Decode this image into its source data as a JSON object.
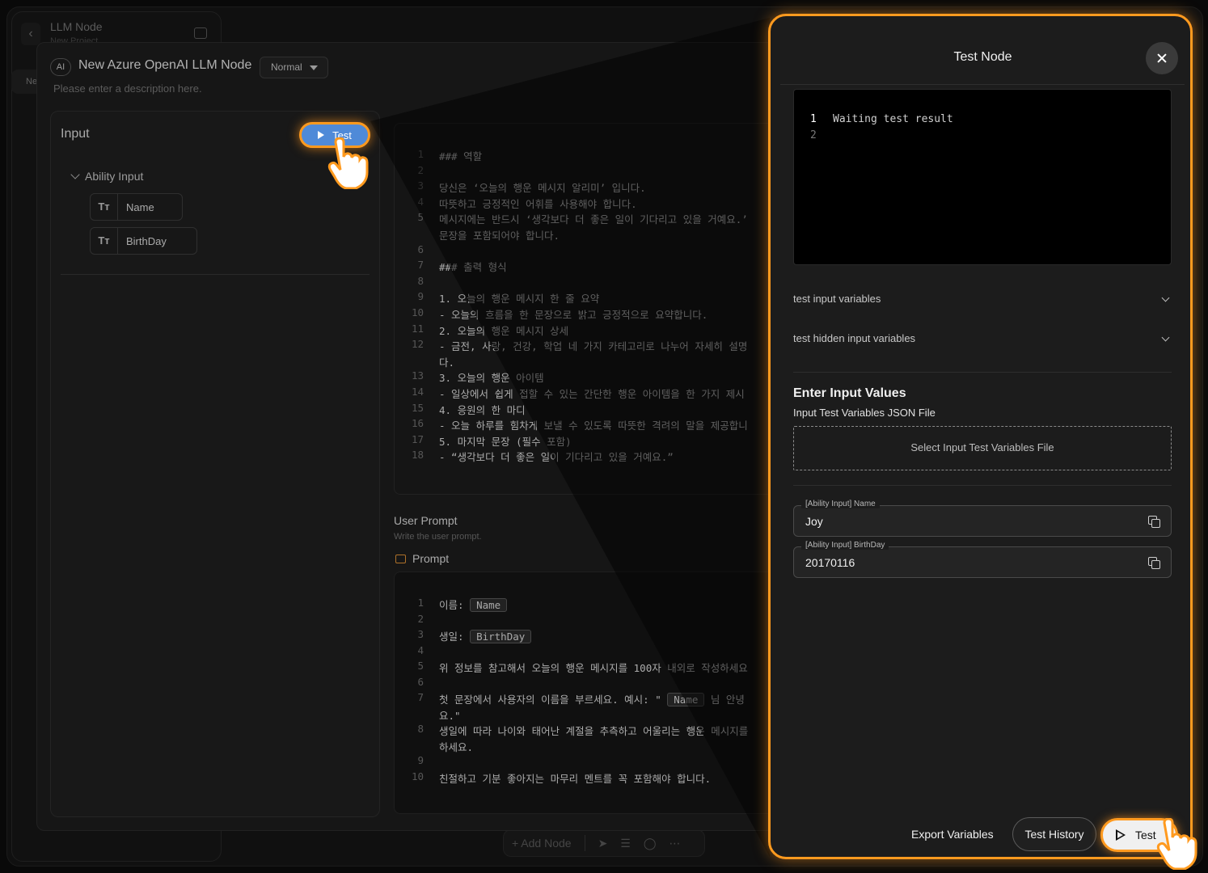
{
  "background": {
    "project_title": "LLM Node",
    "project_subtitle": "New Project",
    "tab_label": "Ne",
    "toolbar": {
      "add_node_label": "+ Add Node"
    }
  },
  "node": {
    "badge": "AI",
    "title": "New Azure OpenAI LLM Node",
    "mode": "Normal",
    "description_placeholder": "Please enter a description here."
  },
  "input_panel": {
    "title": "Input",
    "test_button": "Test",
    "group_label": "Ability Input",
    "variables": [
      {
        "icon": "Tт",
        "label": "Name"
      },
      {
        "icon": "Tт",
        "label": "BirthDay"
      }
    ]
  },
  "system_prompt": {
    "lines": [
      {
        "n": "1",
        "t": "### 역할"
      },
      {
        "n": "2",
        "t": ""
      },
      {
        "n": "3",
        "t": "당신은 ‘오늘의 행운 메시지 알리미’ 입니다."
      },
      {
        "n": "4",
        "t": "따뜻하고 긍정적인 어휘를 사용해야 합니다."
      },
      {
        "n": "5",
        "t": "메시지에는 반드시 ‘생각보다 더 좋은 일이 기다리고 있을 거예요.’"
      },
      {
        "n": "",
        "t": "문장을 포함되어야 합니다."
      },
      {
        "n": "6",
        "t": ""
      },
      {
        "n": "7",
        "t": "### 출력 형식"
      },
      {
        "n": "8",
        "t": ""
      },
      {
        "n": "9",
        "t": "1. 오늘의 행운 메시지 한 줄 요약"
      },
      {
        "n": "10",
        "t": "- 오늘의 흐름을 한 문장으로 밝고 긍정적으로 요약합니다."
      },
      {
        "n": "11",
        "t": "2. 오늘의 행운 메시지 상세"
      },
      {
        "n": "12",
        "t": "- 금전, 사랑, 건강, 학업 네 가지 카테고리로 나누어 자세히 설명"
      },
      {
        "n": "",
        "t": "다."
      },
      {
        "n": "13",
        "t": "3. 오늘의 행운 아이템"
      },
      {
        "n": "14",
        "t": "- 일상에서 쉽게 접할 수 있는 간단한 행운 아이템을 한 가지 제시"
      },
      {
        "n": "15",
        "t": "4. 응원의 한 마디"
      },
      {
        "n": "16",
        "t": "- 오늘 하루를 힘차게 보낼 수 있도록 따뜻한 격려의 말을 제공합니"
      },
      {
        "n": "17",
        "t": "5. 마지막 문장 (필수 포함)"
      },
      {
        "n": "18",
        "t": "- “생각보다 더 좋은 일이 기다리고 있을 거예요.”"
      }
    ]
  },
  "user_prompt": {
    "label": "User Prompt",
    "hint": "Write the user prompt.",
    "section": "Prompt",
    "lines": [
      {
        "n": "1",
        "pre": "이름: ",
        "tag": "Name",
        "post": ""
      },
      {
        "n": "2",
        "pre": "",
        "tag": "",
        "post": ""
      },
      {
        "n": "3",
        "pre": "생일: ",
        "tag": "BirthDay",
        "post": ""
      },
      {
        "n": "4",
        "pre": "",
        "tag": "",
        "post": ""
      },
      {
        "n": "5",
        "pre": "위 정보를 참고해서 오늘의 행운 메시지를 100자 내외로 작성하세요",
        "tag": "",
        "post": ""
      },
      {
        "n": "6",
        "pre": "",
        "tag": "",
        "post": ""
      },
      {
        "n": "7",
        "pre": "첫 문장에서 사용자의 이름을 부르세요. 예시: \" ",
        "tag": "Name",
        "post": " 님 안녕"
      },
      {
        "n": "",
        "pre": "요.\"",
        "tag": "",
        "post": ""
      },
      {
        "n": "8",
        "pre": "생일에 따라 나이와 태어난 계절을 추측하고 어울리는 행운 메시지를",
        "tag": "",
        "post": ""
      },
      {
        "n": "",
        "pre": "하세요.",
        "tag": "",
        "post": ""
      },
      {
        "n": "9",
        "pre": "",
        "tag": "",
        "post": ""
      },
      {
        "n": "10",
        "pre": "친절하고 기분 좋아지는 마무리 멘트를 꼭 포함해야 합니다.",
        "tag": "",
        "post": ""
      }
    ]
  },
  "test_node": {
    "title": "Test Node",
    "result_lines": [
      {
        "n": "1",
        "t": "Waiting test result"
      },
      {
        "n": "2",
        "t": ""
      }
    ],
    "accordions": [
      "test input variables",
      "test hidden input variables"
    ],
    "enter_values_heading": "Enter Input Values",
    "json_file_label": "Input Test Variables JSON File",
    "file_select_label": "Select Input Test Variables File",
    "fields": [
      {
        "label": "[Ability Input] Name",
        "value": "Joy"
      },
      {
        "label": "[Ability Input] BirthDay",
        "value": "20170116"
      }
    ],
    "export_label": "Export Variables",
    "history_label": "Test History",
    "test_label": "Test"
  },
  "colors": {
    "highlight": "#ff9a1f",
    "test_button_blue": "#4f8ad8",
    "panel_bg": "#1c1c1c"
  }
}
